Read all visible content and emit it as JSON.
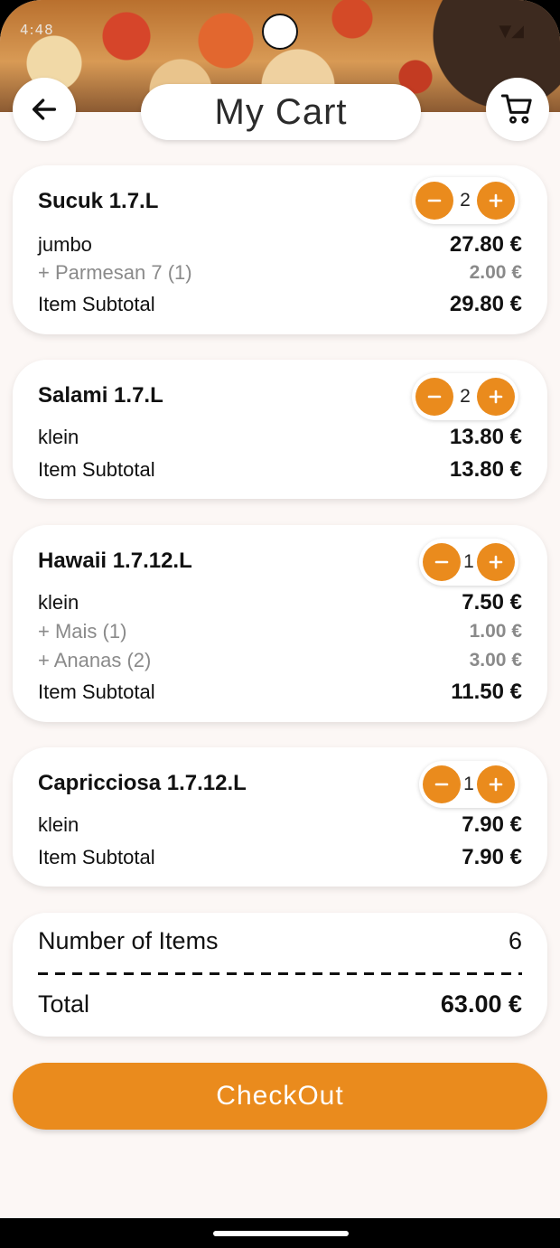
{
  "status_bar": {
    "time": "4:48"
  },
  "header": {
    "title": "My Cart"
  },
  "colors": {
    "accent": "#ea8b1d",
    "background": "#fcf7f5",
    "muted": "#8a8a8a"
  },
  "icons": {
    "back": "arrow-left-icon",
    "cart": "shopping-cart-icon",
    "minus": "minus-icon",
    "plus": "plus-icon"
  },
  "items": [
    {
      "name": "Sucuk 1.7.L",
      "qty": "2",
      "size": "jumbo",
      "size_price": "27.80 €",
      "extras": [
        {
          "label": "+ Parmesan 7 (1)",
          "price": "2.00 €"
        }
      ],
      "subtotal_label": "Item Subtotal",
      "subtotal": "29.80 €"
    },
    {
      "name": "Salami 1.7.L",
      "qty": "2",
      "size": "klein",
      "size_price": "13.80 €",
      "extras": [],
      "subtotal_label": "Item Subtotal",
      "subtotal": "13.80 €"
    },
    {
      "name": "Hawaii 1.7.12.L",
      "qty": "1",
      "size": "klein",
      "size_price": "7.50 €",
      "extras": [
        {
          "label": "+ Mais (1)",
          "price": "1.00 €"
        },
        {
          "label": "+ Ananas (2)",
          "price": "3.00 €"
        }
      ],
      "subtotal_label": "Item Subtotal",
      "subtotal": "11.50 €"
    },
    {
      "name": "Capricciosa 1.7.12.L",
      "qty": "1",
      "size": "klein",
      "size_price": "7.90 €",
      "extras": [],
      "subtotal_label": "Item Subtotal",
      "subtotal": "7.90 €"
    }
  ],
  "summary": {
    "count_label": "Number of Items",
    "count": "6",
    "total_label": "Total",
    "total": "63.00 €"
  },
  "checkout": {
    "label": "CheckOut"
  }
}
